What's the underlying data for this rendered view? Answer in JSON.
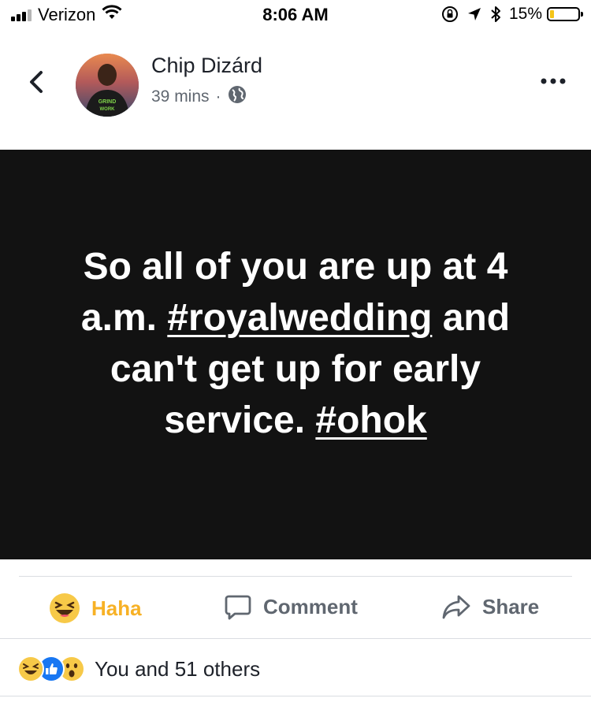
{
  "status_bar": {
    "carrier": "Verizon",
    "time": "8:06 AM",
    "battery_percent": "15%",
    "signal_bars_active": 3,
    "signal_bars_total": 4,
    "battery_level": 0.15,
    "icons": [
      "wifi-icon",
      "rotation-lock-icon",
      "location-icon",
      "bluetooth-icon"
    ]
  },
  "header": {
    "author_name": "Chip Dizárd",
    "timestamp": "39 mins",
    "separator": "·",
    "privacy_icon": "globe-icon",
    "back_icon": "chevron-left-icon",
    "more_icon": "more-dots-icon",
    "avatar_shirt_text": [
      "GRIND",
      "WORK"
    ]
  },
  "post": {
    "text_before_1": "So all of you are up at 4 a.m. ",
    "hashtag_1": "#royalwedding",
    "text_before_2": " and can't get up for early service. ",
    "hashtag_2": "#ohok",
    "background_color": "#121212"
  },
  "actions": {
    "haha_label": "Haha",
    "comment_label": "Comment",
    "share_label": "Share",
    "haha_color": "#f7b125"
  },
  "reactions": {
    "summary": "You and 51 others",
    "icons": [
      "haha-reaction-icon",
      "like-reaction-icon",
      "wow-reaction-icon"
    ]
  }
}
